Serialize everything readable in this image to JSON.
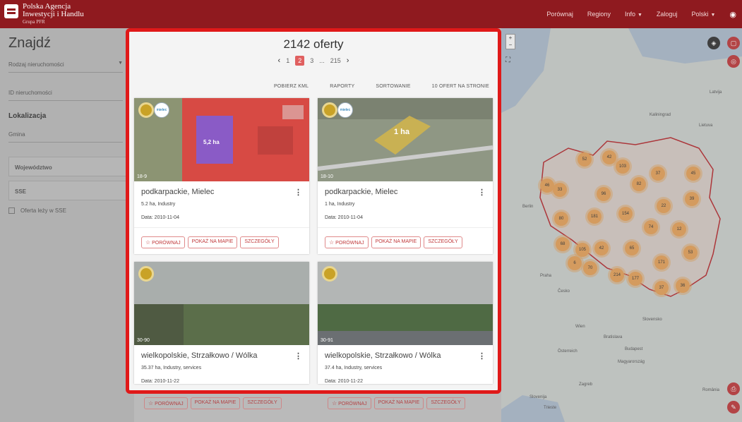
{
  "header": {
    "logo_line1": "Polska Agencja",
    "logo_line2": "Inwestycji i Handlu",
    "logo_line3": "Grupa PFR",
    "nav": [
      "Porównaj",
      "Regiony",
      "Info",
      "Zaloguj",
      "Polski"
    ]
  },
  "filters": {
    "title": "Znajdź",
    "property_type": "Rodzaj nieruchomości",
    "property_id": "ID nieruchomości",
    "location_heading": "Lokalizacja",
    "gmina": "Gmina",
    "voivodeship": "Województwo",
    "sse": "SSE",
    "sse_checkbox": "Oferta leży w SSE"
  },
  "results": {
    "count": "2142 oferty",
    "pages": [
      "1",
      "2",
      "3",
      "...",
      "215"
    ],
    "current_page": "2",
    "toolbar": [
      "POBIERZ KML",
      "RAPORTY",
      "SORTOWANIE",
      "10 OFERT NA STRONIE"
    ],
    "cards": [
      {
        "tag": "18-9",
        "plot_label": "5,2 ha",
        "title": "podkarpackie, Mielec",
        "meta": "5.2 ha, Industry",
        "date": "Data: 2010-11-04"
      },
      {
        "tag": "18-10",
        "plot_label": "1 ha",
        "title": "podkarpackie, Mielec",
        "meta": "1 ha, Industry",
        "date": "Data: 2010-11-04"
      },
      {
        "tag": "30-90",
        "title": "wielkopolskie, Strzałkowo / Wólka",
        "meta": "35.37 ha, Industry, services",
        "date": "Data: 2010-11-22"
      },
      {
        "tag": "30-91",
        "title": "wielkopolskie, Strzałkowo / Wólka",
        "meta": "37.4 ha, Industry, services",
        "date": "Data: 2010-11-22"
      }
    ],
    "badge_text": "mielec",
    "actions": {
      "compare": "PORÓWNAJ",
      "show_map": "POKAŻ NA MAPIE",
      "details": "SZCZEGÓŁY"
    }
  },
  "map": {
    "clusters": [
      "52",
      "42",
      "103",
      "37",
      "45",
      "46",
      "33",
      "96",
      "82",
      "39",
      "181",
      "154",
      "22",
      "80",
      "74",
      "12",
      "68",
      "105",
      "42",
      "65",
      "53",
      "6",
      "70",
      "214",
      "177",
      "171",
      "37",
      "36"
    ],
    "cities": [
      "Berlin",
      "Praha",
      "Wien",
      "Budapest",
      "Bratislava",
      "Zagreb",
      "Lietuva",
      "Latvija",
      "Slovensko",
      "Česko",
      "Österreich",
      "Magyarország",
      "Slovenija",
      "România",
      "Trieste",
      "Kaliningrad"
    ],
    "colors": {
      "cluster": "#e8a35a",
      "border": "#b7282d"
    }
  },
  "colors": {
    "brand": "#8f1a1f",
    "highlight": "#e01919",
    "accent": "#c0393b"
  }
}
